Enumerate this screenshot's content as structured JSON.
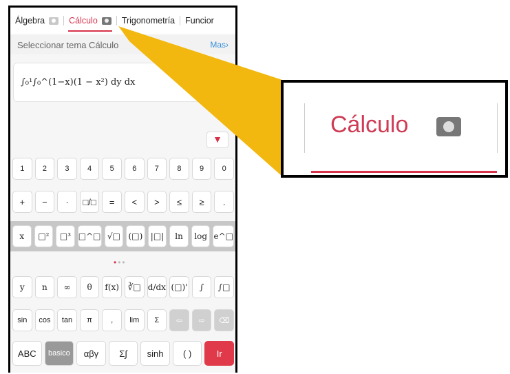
{
  "tabs": [
    {
      "label": "Álgebra",
      "camera": true,
      "active": false
    },
    {
      "label": "Cálculo",
      "camera": true,
      "active": true
    },
    {
      "label": "Trigonometría",
      "camera": false,
      "active": false
    },
    {
      "label": "Funcior",
      "camera": false,
      "active": false
    }
  ],
  "subheader": {
    "title": "Seleccionar tema Cálculo",
    "more": "Mas"
  },
  "input": {
    "expression": "∫₀¹∫₀^(1−x)(1 − x²) dy dx"
  },
  "filter_icon": "▼",
  "keys": {
    "row1": [
      "1",
      "2",
      "3",
      "4",
      "5",
      "6",
      "7",
      "8",
      "9",
      "0"
    ],
    "row2": [
      "+",
      "−",
      "·",
      "□/□",
      "=",
      "<",
      ">",
      "≤",
      "≥",
      "."
    ],
    "row3": [
      "x",
      "□²",
      "□³",
      "□^□",
      "√□",
      "(□)",
      "|□|",
      "ln",
      "log",
      "e^□"
    ],
    "row4": [
      "y",
      "n",
      "∞",
      "θ",
      "f(x)",
      "∛□",
      "d/dx",
      "(□)'",
      "∫",
      "∫□"
    ],
    "row5": [
      "sin",
      "cos",
      "tan",
      "π",
      ",",
      "lim",
      "Σ",
      "⇦",
      "⇨",
      "⌫"
    ],
    "row6": [
      "ABC",
      "basico",
      "αβγ",
      "Σ∫",
      "sinh",
      "( )",
      "Ir"
    ]
  },
  "zoom": {
    "label": "Cálculo"
  },
  "colors": {
    "accent": "#d6324a",
    "link": "#3b8fd8",
    "callout": "#f2b80f"
  }
}
